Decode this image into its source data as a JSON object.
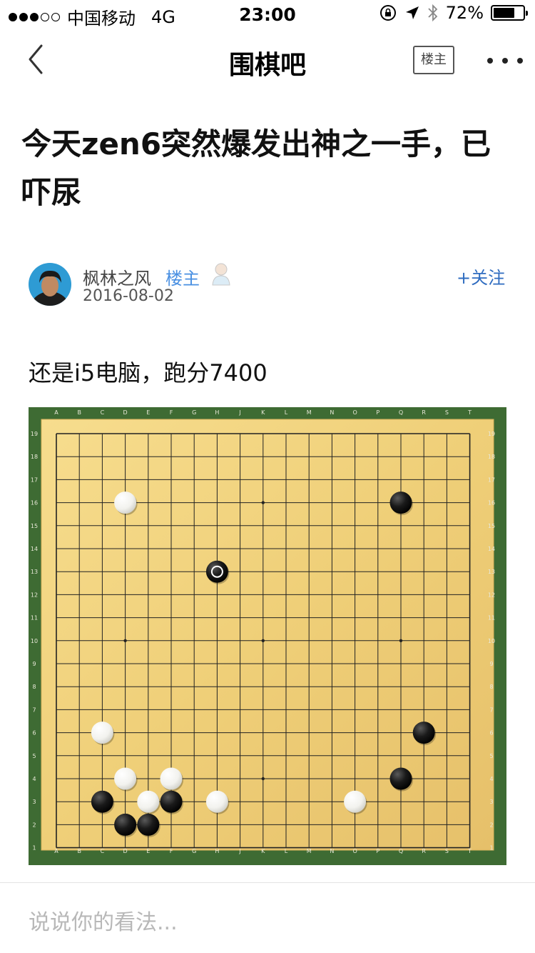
{
  "status_bar": {
    "carrier": "中国移动",
    "network": "4G",
    "time": "23:00",
    "battery": "72%",
    "battery_level": 0.72
  },
  "nav": {
    "title": "围棋吧",
    "op_only_label": "楼主"
  },
  "post": {
    "title": "今天zen6突然爆发出神之一手，已吓尿",
    "author": "枫林之风",
    "op_badge": "楼主",
    "date": "2016-08-02",
    "follow_label": "+关注",
    "body": "还是i5电脑，跑分7400"
  },
  "board": {
    "columns": [
      "A",
      "B",
      "C",
      "D",
      "E",
      "F",
      "G",
      "H",
      "J",
      "K",
      "L",
      "M",
      "N",
      "O",
      "P",
      "Q",
      "R",
      "S",
      "T"
    ],
    "rows": [
      "19",
      "18",
      "17",
      "16",
      "15",
      "14",
      "13",
      "12",
      "11",
      "10",
      "9",
      "8",
      "7",
      "6",
      "5",
      "4",
      "3",
      "2",
      "1"
    ],
    "stones": [
      {
        "color": "white",
        "point": "D16"
      },
      {
        "color": "black",
        "point": "Q16"
      },
      {
        "color": "black",
        "point": "H13",
        "last_move": true
      },
      {
        "color": "white",
        "point": "C6"
      },
      {
        "color": "black",
        "point": "R6"
      },
      {
        "color": "white",
        "point": "D4"
      },
      {
        "color": "white",
        "point": "F4"
      },
      {
        "color": "black",
        "point": "Q4"
      },
      {
        "color": "black",
        "point": "C3"
      },
      {
        "color": "white",
        "point": "E3"
      },
      {
        "color": "black",
        "point": "F3"
      },
      {
        "color": "white",
        "point": "H3"
      },
      {
        "color": "white",
        "point": "O3"
      },
      {
        "color": "black",
        "point": "D2"
      },
      {
        "color": "black",
        "point": "E2"
      }
    ]
  },
  "comment": {
    "placeholder": "说说你的看法..."
  }
}
